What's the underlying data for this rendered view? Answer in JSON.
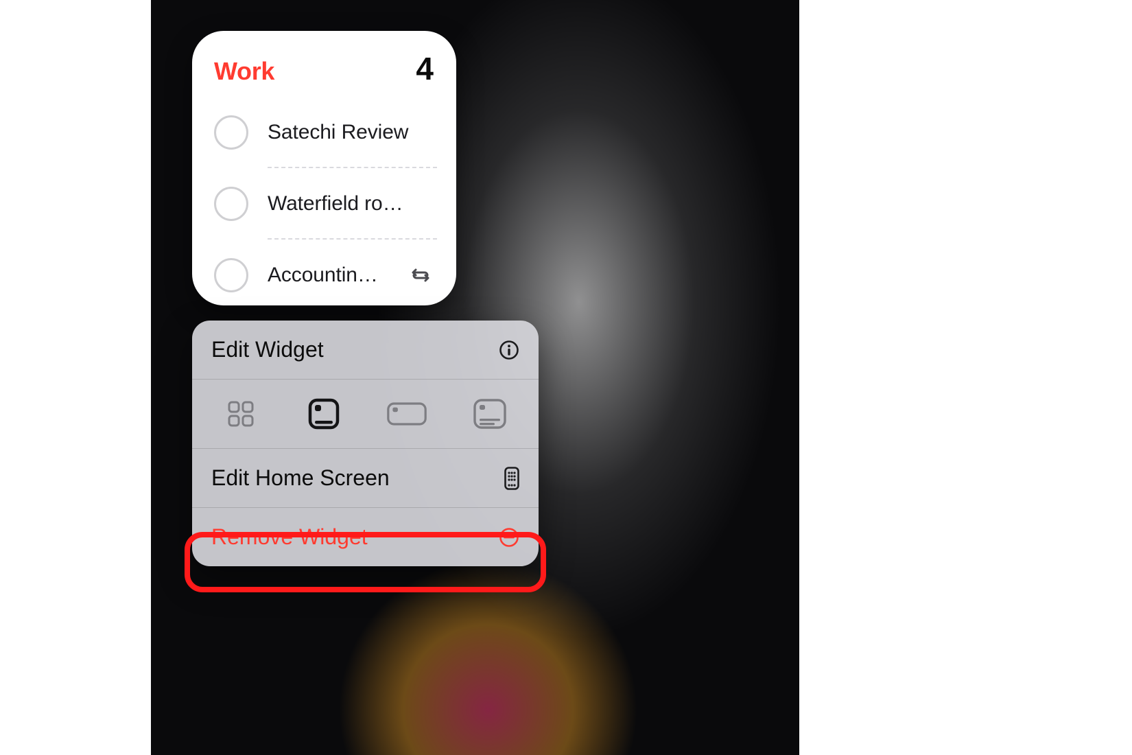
{
  "widget": {
    "title": "Work",
    "count": "4",
    "items": [
      {
        "label": "Satechi Review",
        "repeating": false
      },
      {
        "label": "Waterfield ro…",
        "repeating": false
      },
      {
        "label": "Accountin…",
        "repeating": true
      }
    ]
  },
  "menu": {
    "edit_widget": "Edit Widget",
    "size_options": {
      "small_grid": "small-grid",
      "small_square": "small-square",
      "medium_wide": "medium-wide",
      "large": "large"
    },
    "selected_size": "small-square",
    "edit_home_screen": "Edit Home Screen",
    "remove_widget": "Remove Widget"
  },
  "colors": {
    "accent_red": "#ff3b30"
  }
}
